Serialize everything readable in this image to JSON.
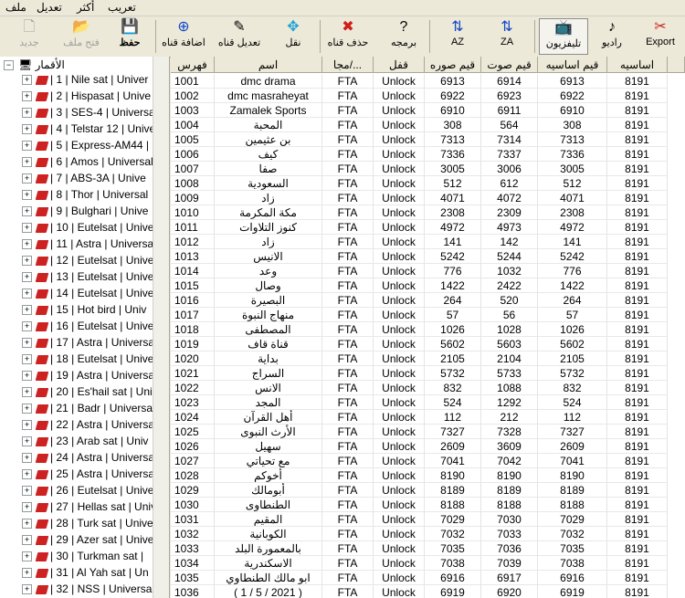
{
  "menu": [
    "ملف",
    "تعديل",
    "أكثر",
    "تعريب"
  ],
  "toolbar": {
    "new": "جديد",
    "open": "فتح ملف",
    "save": "حفظ",
    "add_channel": "اضافة قناه",
    "edit_channel": "تعديل قناه",
    "move": "نقل",
    "delete_channel": "حذف قناه",
    "program": "برمجه",
    "sort_az": "AZ",
    "sort_za": "ZA",
    "tv": "تليفزيون",
    "radio": "راديو",
    "export": "Export"
  },
  "tree": {
    "root": "الأقمار",
    "items": [
      "| 1 | Nile sat | Univer",
      "| 2 | Hispasat | Unive",
      "| 3 | SES-4 | Universa",
      "| 4 | Telstar 12 | Unive",
      "| 5 | Express-AM44 |",
      "| 6 | Amos | Universal",
      "| 7 | ABS-3A | Unive",
      "| 8 | Thor | Universal",
      "| 9 | Bulghari | Unive",
      "| 10 | Eutelsat | Unive",
      "| 11 | Astra | Universa",
      "| 12 | Eutelsat | Unive",
      "| 13 | Eutelsat | Unive",
      "| 14 | Eutelsat | Unive",
      "| 15 | Hot bird | Univ",
      "| 16 | Eutelsat | Unive",
      "| 17 | Astra | Universa",
      "| 18 | Eutelsat | Unive",
      "| 19 | Astra | Universa",
      "| 20 | Es'hail sat | Uni",
      "| 21 | Badr | Universa",
      "| 22 | Astra | Universa",
      "| 23 | Arab sat | Univ",
      "| 24 | Astra | Universa",
      "| 25 | Astra | Universa",
      "| 26 | Eutelsat | Unive",
      "| 27 | Hellas sat | Univ",
      "| 28 | Turk sat | Unive",
      "| 29 | Azer sat | Unive",
      "| 30 | Turkman sat |",
      "| 31 | Al Yah sat | Un",
      "| 32 | NSS | Universal"
    ]
  },
  "grid": {
    "headers": [
      "فهرس",
      "اسم",
      "مجا/...",
      "قفل",
      "قيم صوره",
      "قيم صوت",
      "قيم اساسيه",
      "اساسيه"
    ],
    "rows": [
      [
        "1001",
        "dmc drama",
        "FTA",
        "Unlock",
        "6913",
        "6914",
        "6913",
        "8191"
      ],
      [
        "1002",
        "dmc masraheyat",
        "FTA",
        "Unlock",
        "6922",
        "6923",
        "6922",
        "8191"
      ],
      [
        "1003",
        "Zamalek Sports",
        "FTA",
        "Unlock",
        "6910",
        "6911",
        "6910",
        "8191"
      ],
      [
        "1004",
        "المحبة",
        "FTA",
        "Unlock",
        "308",
        "564",
        "308",
        "8191"
      ],
      [
        "1005",
        "بن عثيمين",
        "FTA",
        "Unlock",
        "7313",
        "7314",
        "7313",
        "8191"
      ],
      [
        "1006",
        "كيف",
        "FTA",
        "Unlock",
        "7336",
        "7337",
        "7336",
        "8191"
      ],
      [
        "1007",
        "صفا",
        "FTA",
        "Unlock",
        "3005",
        "3006",
        "3005",
        "8191"
      ],
      [
        "1008",
        "السعودية",
        "FTA",
        "Unlock",
        "512",
        "612",
        "512",
        "8191"
      ],
      [
        "1009",
        "زاد",
        "FTA",
        "Unlock",
        "4071",
        "4072",
        "4071",
        "8191"
      ],
      [
        "1010",
        "مكة المكرمة",
        "FTA",
        "Unlock",
        "2308",
        "2309",
        "2308",
        "8191"
      ],
      [
        "1011",
        "كنوز التلاوات",
        "FTA",
        "Unlock",
        "4972",
        "4973",
        "4972",
        "8191"
      ],
      [
        "1012",
        "زاد",
        "FTA",
        "Unlock",
        "141",
        "142",
        "141",
        "8191"
      ],
      [
        "1013",
        "الانيس",
        "FTA",
        "Unlock",
        "5242",
        "5244",
        "5242",
        "8191"
      ],
      [
        "1014",
        "وعد",
        "FTA",
        "Unlock",
        "776",
        "1032",
        "776",
        "8191"
      ],
      [
        "1015",
        "وصال",
        "FTA",
        "Unlock",
        "1422",
        "2422",
        "1422",
        "8191"
      ],
      [
        "1016",
        "البصيرة",
        "FTA",
        "Unlock",
        "264",
        "520",
        "264",
        "8191"
      ],
      [
        "1017",
        "منهاج النبوة",
        "FTA",
        "Unlock",
        "57",
        "56",
        "57",
        "8191"
      ],
      [
        "1018",
        "المصطفى",
        "FTA",
        "Unlock",
        "1026",
        "1028",
        "1026",
        "8191"
      ],
      [
        "1019",
        "قناة قاف",
        "FTA",
        "Unlock",
        "5602",
        "5603",
        "5602",
        "8191"
      ],
      [
        "1020",
        "بداية",
        "FTA",
        "Unlock",
        "2105",
        "2104",
        "2105",
        "8191"
      ],
      [
        "1021",
        "السراج",
        "FTA",
        "Unlock",
        "5732",
        "5733",
        "5732",
        "8191"
      ],
      [
        "1022",
        "الانس",
        "FTA",
        "Unlock",
        "832",
        "1088",
        "832",
        "8191"
      ],
      [
        "1023",
        "المجد",
        "FTA",
        "Unlock",
        "524",
        "1292",
        "524",
        "8191"
      ],
      [
        "1024",
        "أهل القرآن",
        "FTA",
        "Unlock",
        "112",
        "212",
        "112",
        "8191"
      ],
      [
        "1025",
        "الأرث النبوى",
        "FTA",
        "Unlock",
        "7327",
        "7328",
        "7327",
        "8191"
      ],
      [
        "1026",
        "سهيل",
        "FTA",
        "Unlock",
        "2609",
        "3609",
        "2609",
        "8191"
      ],
      [
        "1027",
        "مع تحياتي",
        "FTA",
        "Unlock",
        "7041",
        "7042",
        "7041",
        "8191"
      ],
      [
        "1028",
        "أخوكم",
        "FTA",
        "Unlock",
        "8190",
        "8190",
        "8190",
        "8191"
      ],
      [
        "1029",
        "أبومالك",
        "FTA",
        "Unlock",
        "8189",
        "8189",
        "8189",
        "8191"
      ],
      [
        "1030",
        "الطنطاوى",
        "FTA",
        "Unlock",
        "8188",
        "8188",
        "8188",
        "8191"
      ],
      [
        "1031",
        "المقيم",
        "FTA",
        "Unlock",
        "7029",
        "7030",
        "7029",
        "8191"
      ],
      [
        "1032",
        "الكوبانية",
        "FTA",
        "Unlock",
        "7032",
        "7033",
        "7032",
        "8191"
      ],
      [
        "1033",
        "بالمعمورة البلد",
        "FTA",
        "Unlock",
        "7035",
        "7036",
        "7035",
        "8191"
      ],
      [
        "1034",
        "الاسكندرية",
        "FTA",
        "Unlock",
        "7038",
        "7039",
        "7038",
        "8191"
      ],
      [
        "1035",
        "ابو مالك الطنطاوي",
        "FTA",
        "Unlock",
        "6916",
        "6917",
        "6916",
        "8191"
      ],
      [
        "1036",
        "( 1 / 5 / 2021 )",
        "FTA",
        "Unlock",
        "6919",
        "6920",
        "6919",
        "8191"
      ]
    ]
  }
}
